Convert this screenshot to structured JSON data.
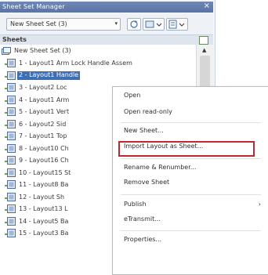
{
  "window": {
    "title": "Sheet Set Manager",
    "close_glyph": "×"
  },
  "toolbar": {
    "combo_value": "New Sheet Set (3)",
    "combo_arrow": "▾"
  },
  "sheets": {
    "header_label": "Sheets"
  },
  "tree": {
    "root_label": "New Sheet Set (3)",
    "rows": [
      {
        "label": "1 - Layout1 Arm Lock Handle Assem",
        "selected": false
      },
      {
        "label": "2 - Layout1 Handle",
        "selected": true
      },
      {
        "label": "3 - Layout2 Loc",
        "selected": false
      },
      {
        "label": "4 - Layout1 Arm",
        "selected": false
      },
      {
        "label": "5 - Layout1 Vert",
        "selected": false
      },
      {
        "label": "6 - Layout2 Sid",
        "selected": false
      },
      {
        "label": "7 - Layout1 Top",
        "selected": false
      },
      {
        "label": "8 - Layout10 Ch",
        "selected": false
      },
      {
        "label": "9 - Layout16 Ch",
        "selected": false
      },
      {
        "label": "10 - Layout15 St",
        "selected": false
      },
      {
        "label": "11 - Layout8 Ba",
        "selected": false
      },
      {
        "label": "12 - Layout Sh",
        "selected": false
      },
      {
        "label": "13 - Layout13 L",
        "selected": false
      },
      {
        "label": "14 - Layout5 Ba",
        "selected": false
      },
      {
        "label": "15 - Layout3 Ba",
        "selected": false
      }
    ]
  },
  "context_menu": {
    "items": [
      {
        "label": "Open"
      },
      {
        "label": "Open read-only"
      },
      {
        "label": "New Sheet..."
      },
      {
        "label": "Import Layout as Sheet...",
        "highlighted": true
      },
      {
        "label": "Rename & Renumber..."
      },
      {
        "label": "Remove Sheet"
      },
      {
        "label": "Publish",
        "has_submenu": true
      },
      {
        "label": "eTransmit..."
      },
      {
        "label": "Properties..."
      }
    ],
    "submenu_arrow": "›"
  },
  "colors": {
    "title_bar": "#5a74a6",
    "selection": "#3d6fb6",
    "highlight_box": "#c0282f"
  }
}
